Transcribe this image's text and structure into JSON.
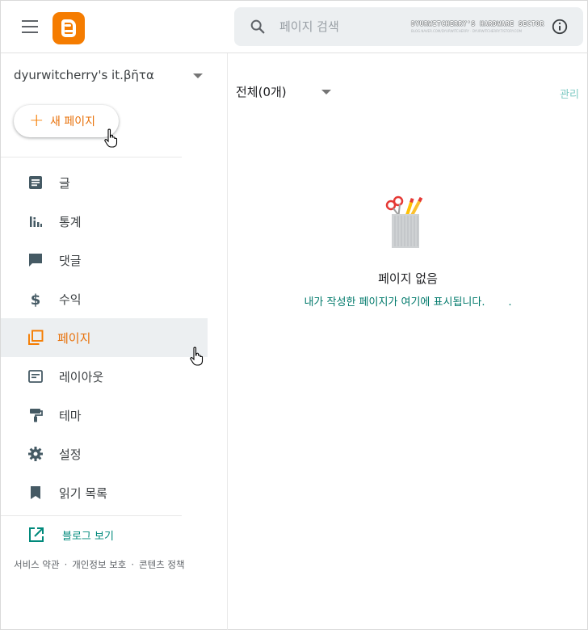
{
  "header": {
    "menu_icon": "hamburger-menu-icon",
    "logo_icon": "blogger-logo-icon",
    "search": {
      "placeholder": "페이지 검색",
      "value": ""
    },
    "watermark_title": "DYURWITCHERRY'S HARDWARE SECTOR",
    "watermark_subtitle": "BLOG.NAVER.COM/DYURWITCHERRY · DYURWITCHERRY.TISTORY.COM",
    "info_icon": "info-icon"
  },
  "sidebar": {
    "blog_name": "dyurwitcherry's it.βῆτα",
    "new_page_label": "새 페이지",
    "items": [
      {
        "label": "글",
        "icon": "posts-icon",
        "active": false
      },
      {
        "label": "통계",
        "icon": "stats-icon",
        "active": false
      },
      {
        "label": "댓글",
        "icon": "comments-icon",
        "active": false
      },
      {
        "label": "수익",
        "icon": "earnings-icon",
        "active": false
      },
      {
        "label": "페이지",
        "icon": "pages-icon",
        "active": true
      },
      {
        "label": "레이아웃",
        "icon": "layout-icon",
        "active": false
      },
      {
        "label": "테마",
        "icon": "theme-icon",
        "active": false
      },
      {
        "label": "설정",
        "icon": "settings-icon",
        "active": false
      },
      {
        "label": "읽기 목록",
        "icon": "reading-list-icon",
        "active": false
      }
    ],
    "view_blog_label": "블로그 보기",
    "footer_links": [
      "서비스 약관",
      "개인정보 보호",
      "콘텐츠 정책"
    ]
  },
  "main": {
    "filter_label": "전체(0개)",
    "manage_label": "관리",
    "empty_title": "페이지 없음",
    "empty_subtitle": "내가 작성한 페이지가 여기에 표시됩니다.       ."
  },
  "colors": {
    "accent": "#f57c00",
    "active_text": "#e8710a",
    "link_teal": "#00897b",
    "active_bg": "#eceff1"
  }
}
